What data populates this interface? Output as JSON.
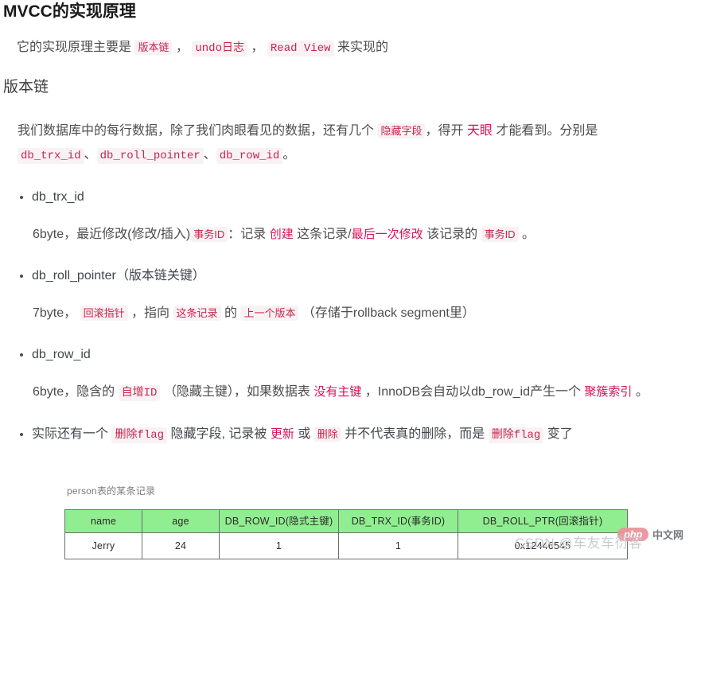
{
  "document": {
    "title": "MVCC的实现原理",
    "intro": {
      "prefix": "它的实现原理主要是 ",
      "code1": "版本链",
      "sep1": " ， ",
      "code2": "undo日志",
      "sep2": " ， ",
      "code3": "Read View",
      "suffix": " 来实现的"
    },
    "section_title": "版本链",
    "hidden_fields_para": {
      "part1": "我们数据库中的每行数据，除了我们肉眼看见的数据，还有几个 ",
      "code_hidden": "隐藏字段",
      "part2": "，得开 ",
      "red_eye": "天眼",
      "part3": " 才能看到。分别是 ",
      "code_trx": "db_trx_id",
      "sep1": "、",
      "code_roll": "db_roll_pointer",
      "sep2": "、",
      "code_row": "db_row_id",
      "end": "。"
    },
    "bullets": [
      {
        "label": "db_trx_id",
        "detail": {
          "p1": "6byte，最近修改(修改/插入)",
          "code1": "事务ID",
          "p2": "：记录 ",
          "red1": "创建",
          "p3": " 这条记录/",
          "red2": "最后一次修改",
          "p4": " 该记录的 ",
          "code2": "事务ID",
          "p5": " 。"
        }
      },
      {
        "label": "db_roll_pointer（版本链关键）",
        "detail": {
          "p1": "7byte， ",
          "code1": "回滚指针",
          "p2": " ，指向 ",
          "code2": "这条记录",
          "p3": " 的 ",
          "code3": "上一个版本",
          "p4": " （存储于rollback segment里）"
        }
      },
      {
        "label": "db_row_id",
        "detail": {
          "p1": "6byte，隐含的 ",
          "code1": "自增ID",
          "p2": " （隐藏主键），如果数据表 ",
          "red1": "没有主键",
          "p3": " ，InnoDB会自动以db_row_id产生一个 ",
          "red2": "聚簇索引",
          "p4": " 。"
        }
      }
    ],
    "last_bullet": {
      "p1": "实际还有一个 ",
      "code1": "删除flag",
      "p2": " 隐藏字段, 记录被 ",
      "red1": "更新",
      "p3": " 或 ",
      "code2": "删除",
      "p4": " 并不代表真的删除，而是 ",
      "code3": "删除flag",
      "p5": " 变了"
    },
    "figure": {
      "caption": "person表的某条记录",
      "headers": [
        "name",
        "age",
        "DB_ROW_ID(隐式主键)",
        "DB_TRX_ID(事务ID)",
        "DB_ROLL_PTR(回滚指针)"
      ],
      "rows": [
        [
          "Jerry",
          "24",
          "1",
          "1",
          "0x12446545"
        ]
      ]
    },
    "watermarks": {
      "csdn": "CSDN @车友车衍客",
      "php_badge": "php",
      "php_cn": "中文网"
    },
    "colors": {
      "code_text": "#c7254e",
      "code_bg": "#f9f2f4",
      "red_text": "#d4145a",
      "table_header_bg": "#90ee90",
      "table_border": "#6e6e6e",
      "body_text": "#4d4d4d"
    }
  }
}
